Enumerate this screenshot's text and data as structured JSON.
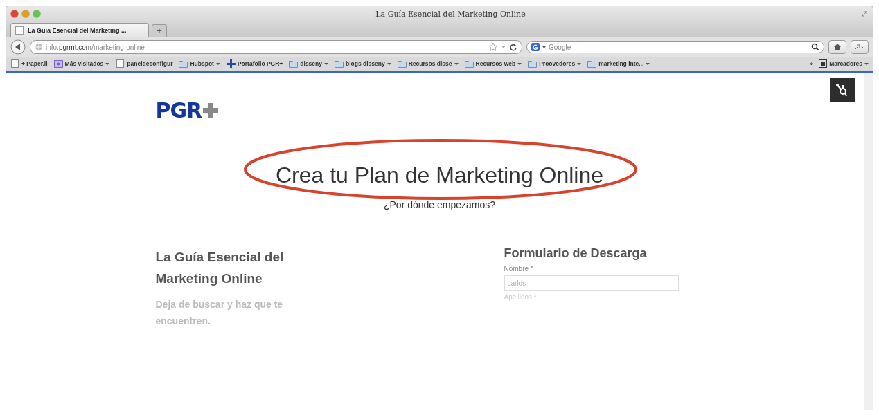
{
  "window": {
    "title": "La Guía Esencial del Marketing Online"
  },
  "tabs": [
    {
      "label": "La Guía Esencial del Marketing ...",
      "selected": true
    }
  ],
  "new_tab": "+",
  "address_bar": {
    "host_prefix": "info.",
    "host": "pgrmt.com",
    "path": "/marketing-online"
  },
  "search": {
    "placeholder": "Google"
  },
  "bookmarks": [
    {
      "label": "+ Paper.li",
      "kind": "page",
      "dropdown": false
    },
    {
      "label": "Más visitados",
      "kind": "smart",
      "dropdown": true
    },
    {
      "label": "paneldeconfigur",
      "kind": "page",
      "dropdown": false
    },
    {
      "label": "Hubspot",
      "kind": "folder",
      "dropdown": true
    },
    {
      "label": "Portafolio PGR+",
      "kind": "plus",
      "dropdown": false
    },
    {
      "label": "disseny",
      "kind": "folder",
      "dropdown": true
    },
    {
      "label": "blogs disseny",
      "kind": "folder",
      "dropdown": true
    },
    {
      "label": "Recursos disse",
      "kind": "folder",
      "dropdown": true
    },
    {
      "label": "Recursos web",
      "kind": "folder",
      "dropdown": true
    },
    {
      "label": "Proovedores",
      "kind": "folder",
      "dropdown": true
    },
    {
      "label": "marketing inte...",
      "kind": "folder",
      "dropdown": true
    }
  ],
  "bookmarks_menu": {
    "overflow": "»",
    "label": "Marcadores"
  },
  "page": {
    "logo": "PGR",
    "headline": "Crea tu Plan de Marketing Online",
    "subheadline": "¿Por dónde empezamos?",
    "guide": {
      "title": "La Guía Esencial del Marketing Online",
      "lead": "Deja de buscar y haz que te encuentren."
    },
    "form": {
      "title": "Formulario de Descarga",
      "fields": [
        {
          "label": "Nombre *",
          "value": "carlos"
        },
        {
          "label": "Apellidos *"
        }
      ]
    }
  }
}
